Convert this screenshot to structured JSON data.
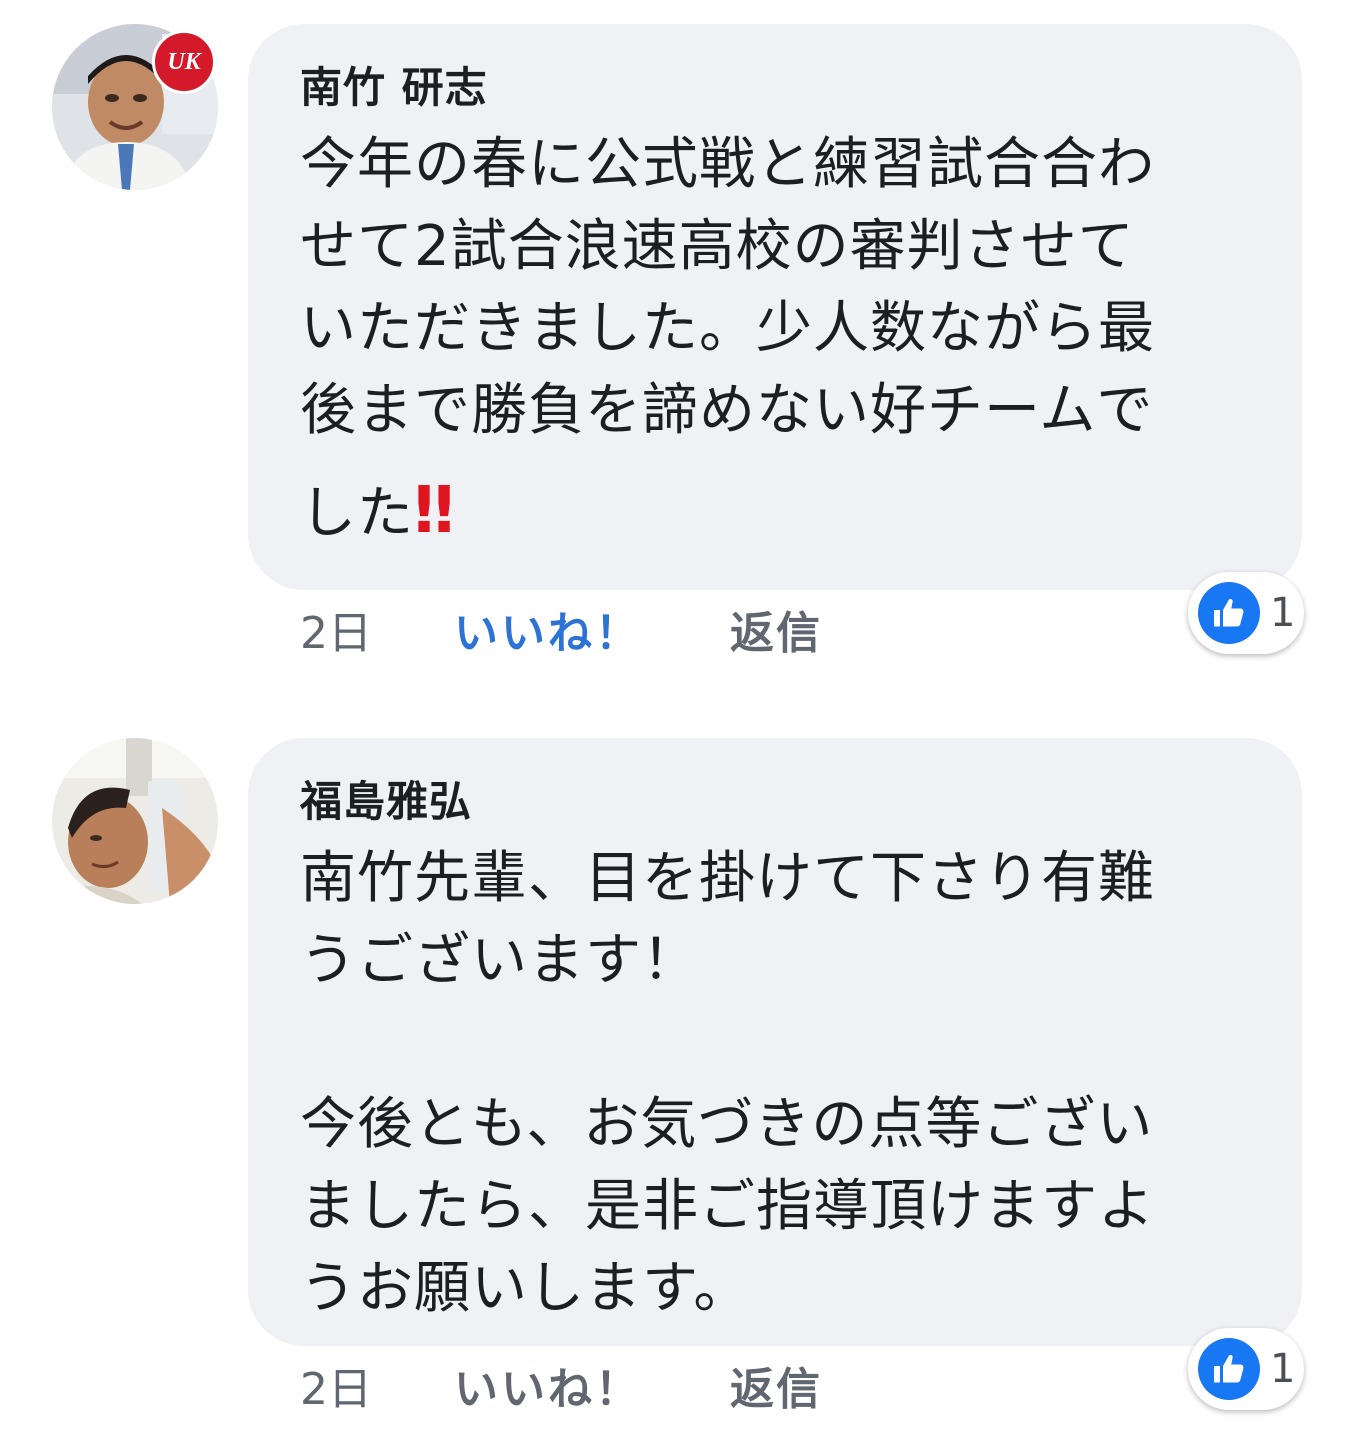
{
  "comments": [
    {
      "author": "南竹 研志",
      "body_lines": [
        "今年の春に公式戦と練習試合合わ",
        "せて2試合浪速高校の審判させて",
        "いただきました。少人数ながら最",
        "後まで勝負を諦めない好チームで"
      ],
      "last_line_text": "した",
      "last_line_emoji": "‼",
      "reaction_count": "1",
      "time": "2日",
      "like_label": "いいね！",
      "like_active": true,
      "reply_label": "返信",
      "avatar_badge": "UK"
    },
    {
      "author": "福島雅弘",
      "body_lines": [
        "南竹先輩、目を掛けて下さり有難",
        "うございます！",
        "",
        "今後とも、お気づきの点等ござい",
        "ましたら、是非ご指導頂けますよ",
        "うお願いします。"
      ],
      "reaction_count": "1",
      "time": "2日",
      "like_label": "いいね！",
      "like_active": false,
      "reply_label": "返信"
    }
  ],
  "colors": {
    "bubble": "#f0f1f4",
    "like_active": "#2d73d6",
    "like_badge": "#1877f2",
    "meta": "#606770",
    "emoji_red": "#e0141e"
  },
  "icons": {
    "reaction": "thumbs-up-icon"
  }
}
